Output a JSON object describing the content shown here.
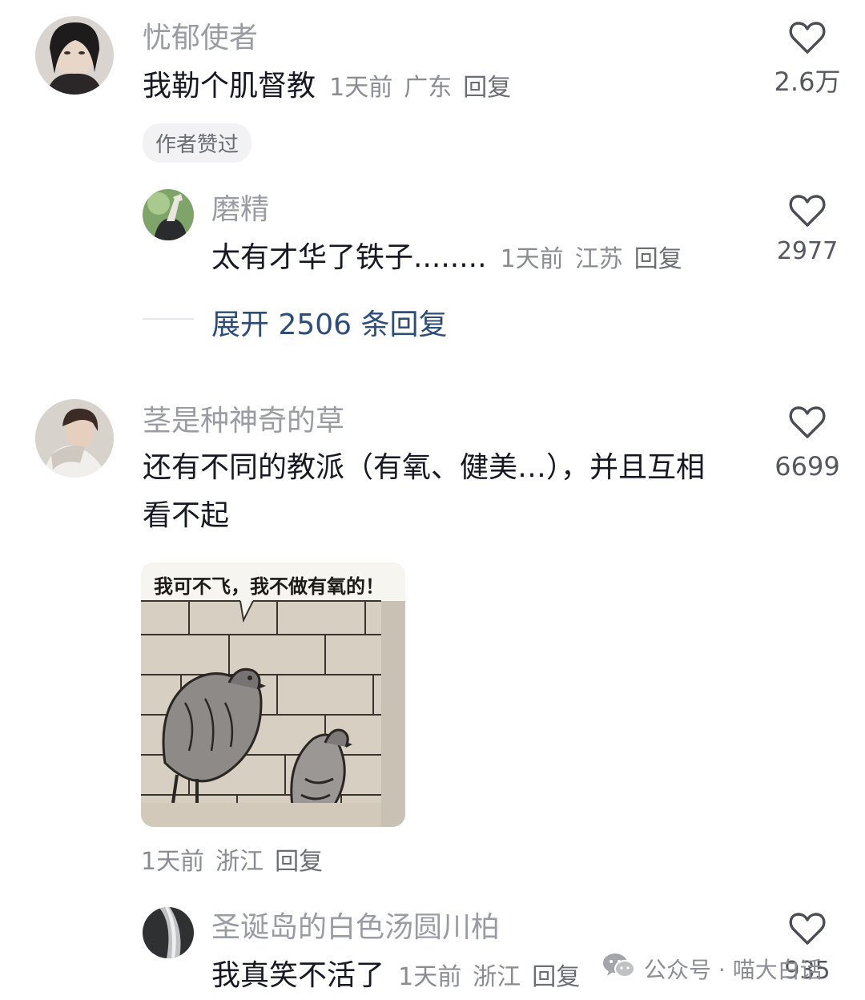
{
  "comments": [
    {
      "username": "忧郁使者",
      "text": "我勒个肌督教",
      "time": "1天前",
      "location": "广东",
      "reply_label": "回复",
      "likes": "2.6万",
      "badge": "作者赞过",
      "sub_reply": {
        "username": "磨精",
        "text": "太有才华了铁子........",
        "time": "1天前",
        "location": "江苏",
        "reply_label": "回复",
        "likes": "2977"
      },
      "expand_label": "展开 2506 条回复"
    },
    {
      "username": "茎是种神奇的草",
      "text_line1": "还有不同的教派（有氧、健美…），并且互相",
      "text_line2": "看不起",
      "likes": "6699",
      "image_caption": "我可不飞，我不做有氧的！",
      "time": "1天前",
      "location": "浙江",
      "reply_label": "回复",
      "sub_reply": {
        "username": "圣诞岛的白色汤圆川柏",
        "text": "我真笑不活了",
        "time": "1天前",
        "location": "浙江",
        "reply_label": "回复",
        "likes": "935"
      }
    }
  ],
  "watermark": {
    "text": "公众号 · 喵大白话",
    "icon": "wechat-icon"
  },
  "colors": {
    "username": "#9a9ca3",
    "link": "#2d4c78",
    "text": "#161823"
  }
}
